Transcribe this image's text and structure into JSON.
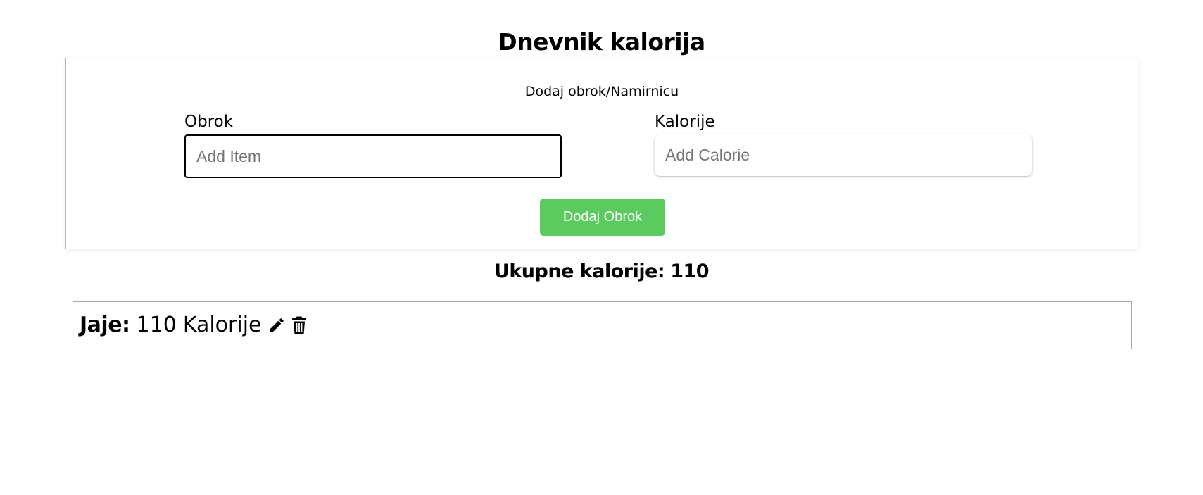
{
  "page": {
    "title": "Dnevnik kalorija"
  },
  "form": {
    "heading": "Dodaj obrok/Namirnicu",
    "item_label": "Obrok",
    "item_placeholder": "Add Item",
    "item_value": "",
    "calorie_label": "Kalorije",
    "calorie_placeholder": "Add Calorie",
    "calorie_value": "",
    "submit_label": "Dodaj Obrok",
    "submit_color": "#5ccb5f"
  },
  "summary": {
    "total_label": "Ukupne kalorije:",
    "total_value": "110"
  },
  "meals": [
    {
      "name": "Jaje:",
      "calories": "110",
      "unit": "Kalorije",
      "edit_icon": "pencil-icon",
      "delete_icon": "trash-icon"
    }
  ]
}
